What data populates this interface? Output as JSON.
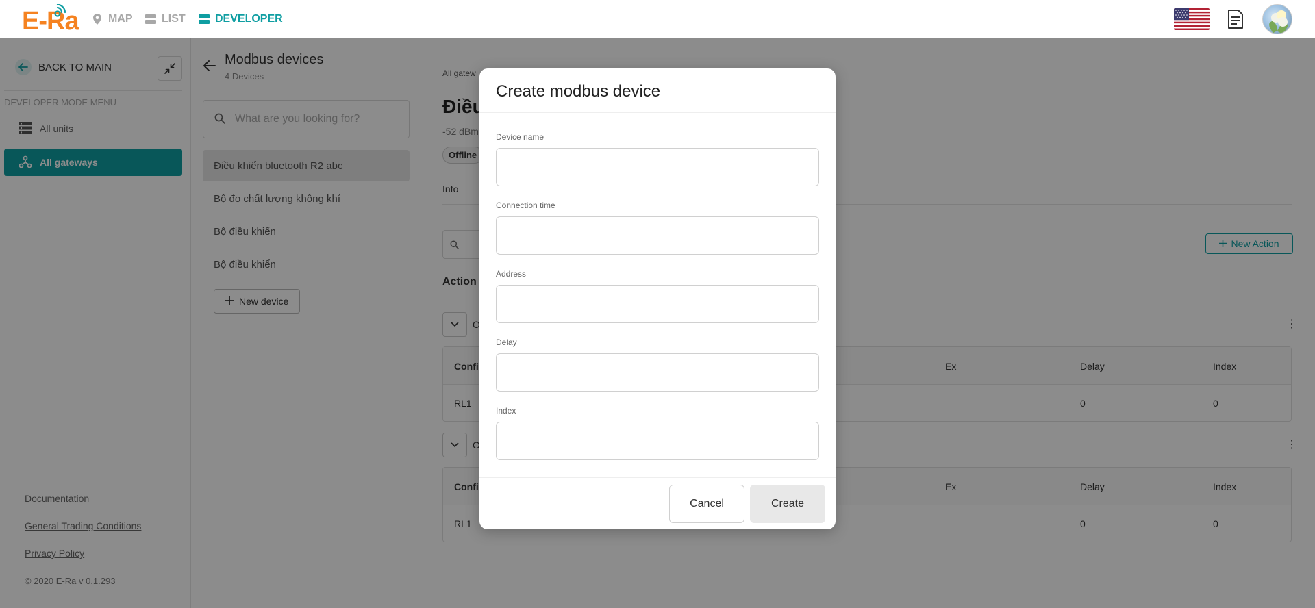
{
  "brand": {
    "logo_text": "E-Ra",
    "color": "#f58220"
  },
  "nav": {
    "map_label": "MAP",
    "list_label": "LIST",
    "developer_label": "DEVELOPER",
    "active_color": "#0f9ea2"
  },
  "header_icons": {
    "flag": "us-flag-icon",
    "document": "document-icon",
    "avatar": "avatar"
  },
  "sidebar": {
    "back_label": "BACK TO MAIN",
    "menu_heading": "DEVELOPER MODE MENU",
    "items": [
      {
        "label": "All units",
        "icon": "units-icon",
        "active": false
      },
      {
        "label": "All gateways",
        "icon": "gateway-icon",
        "active": true
      }
    ],
    "footer_links": [
      "Documentation",
      "General Trading Conditions",
      "Privacy Policy"
    ],
    "copyright": "© 2020 E-Ra v 0.1.293"
  },
  "devices_panel": {
    "title": "Modbus devices",
    "subtitle": "4 Devices",
    "search_placeholder": "What are you looking for?",
    "devices": [
      {
        "name": "Điều khiển bluetooth R2 abc",
        "active": true
      },
      {
        "name": "Bộ đo chất lượng không khí",
        "active": false
      },
      {
        "name": "Bộ điều khiển",
        "active": false
      },
      {
        "name": "Bộ điều khiển",
        "active": false
      }
    ],
    "new_device_label": "New device"
  },
  "main": {
    "breadcrumb": "All gatew",
    "heading": "Điều",
    "rssi": "-52 dBm",
    "status": "Offline",
    "tab": "Info",
    "new_action_label": "New Action",
    "action_section_label": "Action l",
    "group_letter": "O",
    "tables": [
      {
        "headers": {
          "config": "Confi",
          "ex": "Ex",
          "delay": "Delay",
          "index": "Index"
        },
        "row": {
          "config": "RL1",
          "delay": "0",
          "index": "0"
        }
      },
      {
        "headers": {
          "config": "Confi",
          "ex": "Ex",
          "delay": "Delay",
          "index": "Index"
        },
        "row": {
          "config": "RL1",
          "delay": "0",
          "index": "0"
        }
      }
    ]
  },
  "modal": {
    "title": "Create modbus device",
    "fields": [
      {
        "label": "Device name",
        "value": ""
      },
      {
        "label": "Connection time",
        "value": ""
      },
      {
        "label": "Address",
        "value": ""
      },
      {
        "label": "Delay",
        "value": ""
      },
      {
        "label": "Index",
        "value": ""
      }
    ],
    "cancel_label": "Cancel",
    "create_label": "Create"
  }
}
